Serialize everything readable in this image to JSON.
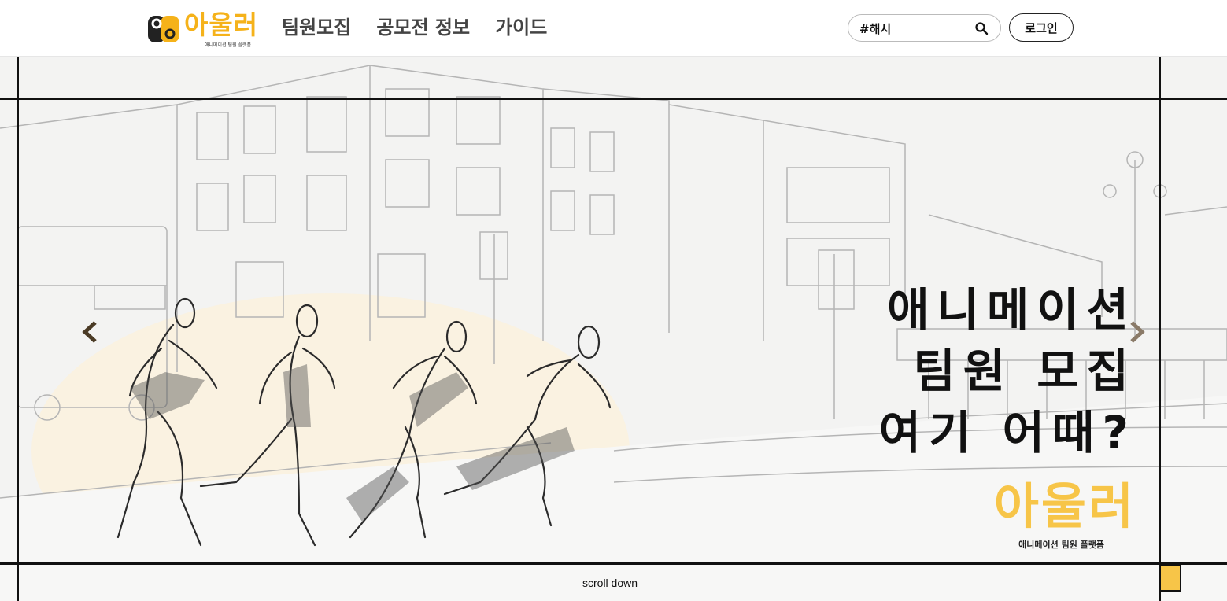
{
  "header": {
    "logo": {
      "text": "아울러",
      "subtitle": "애니메이션 팀원 플랫폼"
    },
    "nav": [
      {
        "label": "팀원모집"
      },
      {
        "label": "공모전 정보"
      },
      {
        "label": "가이드"
      }
    ],
    "search": {
      "value": "#해시",
      "icon": "search-icon"
    },
    "login_label": "로그인"
  },
  "hero": {
    "headline": [
      "애니메이션",
      "팀원 모집",
      "여기 어때?"
    ],
    "brand": "아울러",
    "brand_subtitle": "애니메이션 팀원 플랫폼",
    "prev_icon": "chevron-left-icon",
    "next_icon": "chevron-right-icon",
    "scroll_label": "scroll down"
  },
  "colors": {
    "accent": "#f7c548",
    "logo": "#f5b21a",
    "text": "#111111"
  }
}
